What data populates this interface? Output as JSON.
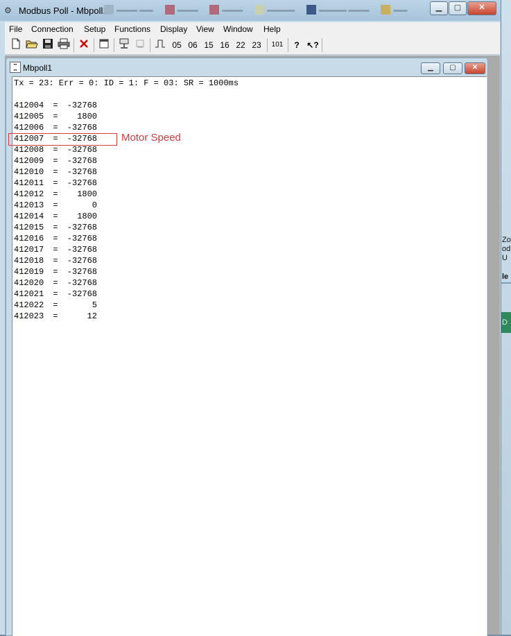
{
  "app": {
    "title": "Modbus Poll - Mbpoll1",
    "window_buttons": {
      "minimize": "▁",
      "maximize": "▢",
      "close": "✕"
    }
  },
  "menu": [
    "File",
    "Connection",
    "Setup",
    "Functions",
    "Display",
    "View",
    "Window",
    "Help"
  ],
  "toolbar": {
    "new_icon": "new-document-icon",
    "open_icon": "open-folder-icon",
    "save_icon": "save-icon",
    "print_icon": "printer-icon",
    "delete_icon": "delete-icon",
    "window_icon": "window-icon",
    "connect_icon": "connect-icon",
    "disconnect_icon": "disconnect-icon",
    "pulse_icon": "pulse-icon",
    "func_buttons": [
      "05",
      "06",
      "15",
      "16",
      "22",
      "23"
    ],
    "bits_label": "101",
    "help_icon": "help-icon",
    "context_help_icon": "context-help-icon"
  },
  "child": {
    "title": "Mbpoll1",
    "status": "Tx = 23: Err = 0: ID = 1: F = 03: SR = 1000ms",
    "registers": [
      {
        "address": "412004",
        "value": "-32768"
      },
      {
        "address": "412005",
        "value": "1800"
      },
      {
        "address": "412006",
        "value": "-32768"
      },
      {
        "address": "412007",
        "value": "-32768"
      },
      {
        "address": "412008",
        "value": "-32768"
      },
      {
        "address": "412009",
        "value": "-32768"
      },
      {
        "address": "412010",
        "value": "-32768"
      },
      {
        "address": "412011",
        "value": "-32768"
      },
      {
        "address": "412012",
        "value": "1800"
      },
      {
        "address": "412013",
        "value": "0"
      },
      {
        "address": "412014",
        "value": "1800"
      },
      {
        "address": "412015",
        "value": "-32768"
      },
      {
        "address": "412016",
        "value": "-32768"
      },
      {
        "address": "412017",
        "value": "-32768"
      },
      {
        "address": "412018",
        "value": "-32768"
      },
      {
        "address": "412019",
        "value": "-32768"
      },
      {
        "address": "412020",
        "value": "-32768"
      },
      {
        "address": "412021",
        "value": "-32768"
      },
      {
        "address": "412022",
        "value": "5"
      },
      {
        "address": "412023",
        "value": "12"
      }
    ],
    "annotation": "Motor Speed",
    "annotation_color": "#d23c3c"
  },
  "background_fragments": [
    "Zo",
    "od",
    "U",
    "le",
    "D"
  ]
}
